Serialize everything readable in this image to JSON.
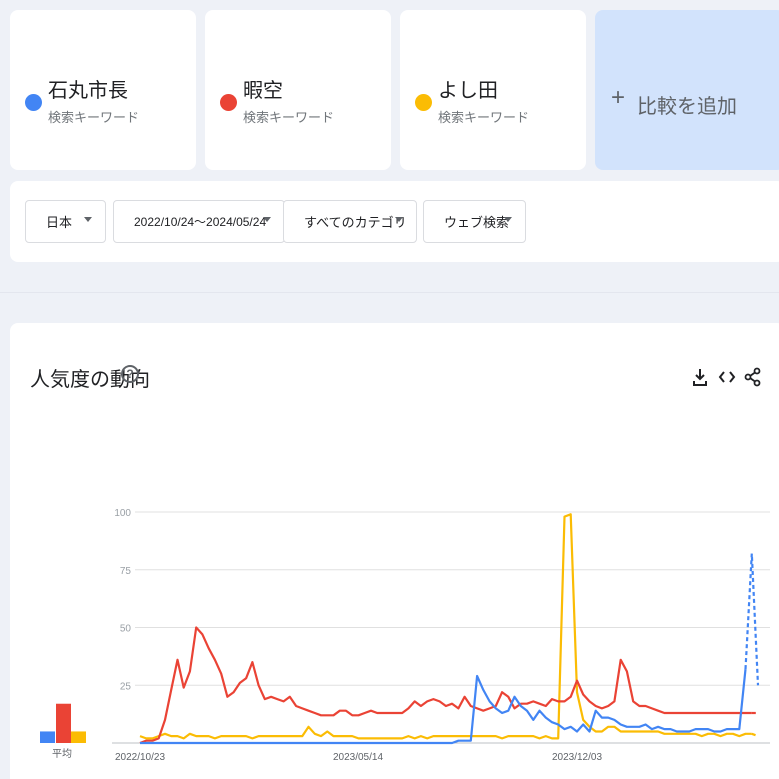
{
  "terms": [
    {
      "name": "石丸市長",
      "sub": "検索キーワード",
      "color": "#4285f4"
    },
    {
      "name": "暇空",
      "sub": "検索キーワード",
      "color": "#ea4335"
    },
    {
      "name": "よし田",
      "sub": "検索キーワード",
      "color": "#fbbc04"
    }
  ],
  "add": {
    "plus": "+",
    "label": "比較を追加"
  },
  "filters": {
    "region": "日本",
    "period": "2022/10/24～2024/05/24",
    "category": "すべてのカテゴリ",
    "search_type": "ウェブ検索"
  },
  "chart_section": {
    "title": "人気度の動向",
    "help": "?",
    "icons": [
      "download-icon",
      "embed-icon",
      "share-icon"
    ]
  },
  "chart_data": {
    "type": "line",
    "ylim": [
      0,
      100
    ],
    "y_ticks": [
      "100",
      "75",
      "50",
      "25"
    ],
    "x_tick_labels": [
      "2022/10/23",
      "2023/05/14",
      "2023/12/03"
    ],
    "average_label": "平均",
    "averages": {
      "石丸市長": 5,
      "暇空": 17,
      "よし田": 5
    },
    "series": [
      {
        "name": "石丸市長",
        "color": "#4285f4",
        "values": [
          0,
          0,
          0,
          0,
          0,
          0,
          0,
          0,
          0,
          0,
          0,
          0,
          0,
          0,
          0,
          0,
          0,
          0,
          0,
          0,
          0,
          0,
          0,
          0,
          0,
          0,
          0,
          0,
          0,
          0,
          0,
          0,
          0,
          0,
          0,
          0,
          0,
          0,
          0,
          0,
          0,
          0,
          0,
          0,
          0,
          0,
          0,
          0,
          0,
          0,
          0,
          1,
          1,
          1,
          29,
          23,
          18,
          15,
          13,
          14,
          20,
          16,
          14,
          10,
          14,
          11,
          9,
          8,
          6,
          7,
          5,
          8,
          5,
          14,
          11,
          11,
          10,
          8,
          7,
          7,
          7,
          8,
          6,
          7,
          6,
          6,
          5,
          5,
          5,
          6,
          6,
          6,
          5,
          5,
          6,
          6,
          6,
          32,
          82,
          25
        ],
        "partial_from_index": 98
      },
      {
        "name": "暇空",
        "color": "#ea4335",
        "values": [
          0,
          1,
          1,
          2,
          10,
          23,
          36,
          24,
          31,
          50,
          47,
          41,
          36,
          30,
          20,
          22,
          26,
          28,
          35,
          25,
          19,
          20,
          19,
          18,
          20,
          16,
          15,
          14,
          13,
          12,
          12,
          12,
          14,
          14,
          12,
          12,
          13,
          14,
          13,
          13,
          13,
          13,
          13,
          15,
          18,
          16,
          18,
          19,
          18,
          16,
          17,
          15,
          20,
          16,
          15,
          14,
          15,
          16,
          22,
          20,
          15,
          17,
          17,
          18,
          17,
          16,
          19,
          18,
          18,
          20,
          27,
          21,
          18,
          16,
          15,
          16,
          18,
          36,
          31,
          18,
          16,
          16,
          15,
          14,
          13,
          13,
          13,
          13,
          13,
          13,
          13,
          13,
          13,
          13,
          13,
          13,
          13,
          13,
          13,
          13
        ],
        "partial_from_index": 99
      },
      {
        "name": "よし田",
        "color": "#fbbc04",
        "values": [
          3,
          2,
          2,
          3,
          4,
          3,
          3,
          2,
          4,
          3,
          3,
          3,
          2,
          3,
          3,
          3,
          3,
          3,
          2,
          3,
          3,
          3,
          3,
          3,
          3,
          3,
          3,
          7,
          4,
          3,
          5,
          3,
          3,
          3,
          3,
          2,
          2,
          2,
          2,
          2,
          2,
          2,
          2,
          3,
          2,
          3,
          2,
          3,
          3,
          3,
          3,
          3,
          3,
          3,
          3,
          3,
          3,
          3,
          2,
          3,
          3,
          3,
          3,
          3,
          2,
          3,
          2,
          2,
          98,
          99,
          22,
          10,
          7,
          5,
          5,
          7,
          7,
          5,
          5,
          5,
          5,
          5,
          5,
          5,
          4,
          4,
          4,
          4,
          4,
          4,
          3,
          4,
          4,
          3,
          4,
          4,
          3,
          4,
          4,
          3
        ],
        "partial_from_index": 99
      }
    ]
  }
}
